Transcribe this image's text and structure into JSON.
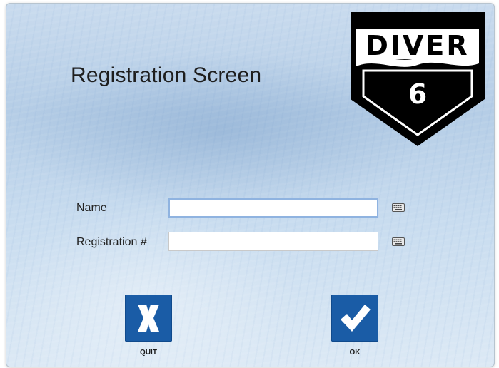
{
  "screen": {
    "title": "Registration Screen"
  },
  "logo": {
    "brand_text": "DIVER",
    "version_text": "6",
    "color": "#000000"
  },
  "form": {
    "name_label": "Name",
    "name_value": "",
    "registration_label": "Registration #",
    "registration_value": ""
  },
  "buttons": {
    "quit_label": "QUIT",
    "ok_label": "OK",
    "quit_icon": "x-icon",
    "ok_icon": "checkmark-icon",
    "button_color": "#1a5ca6"
  }
}
